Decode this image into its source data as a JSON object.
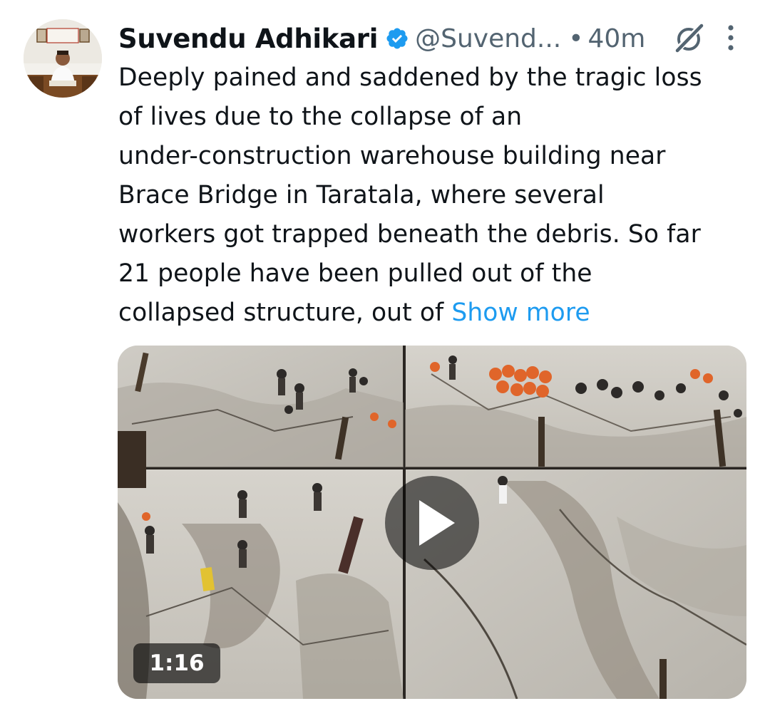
{
  "tweet": {
    "author_name": "Suvendu Adhikari",
    "handle": "@Suvend...",
    "separator": "•",
    "time": "40m",
    "verified_color": "#1d9bf0",
    "text_lines": [
      "Deeply pained and saddened by the tragic loss",
      "of lives due to the collapse of an",
      "under-construction warehouse building near",
      "Brace Bridge in Taratala, where several",
      "workers got trapped beneath the debris. So far",
      "21 people have been pulled out of the",
      "collapsed structure, out of "
    ],
    "show_more": "Show more",
    "show_more_color": "#1d9bf0"
  },
  "media": {
    "duration": "1:16",
    "kind": "video"
  },
  "icons": {
    "verified": "verified-badge-icon",
    "grok": "grok-icon",
    "more": "more-options-icon",
    "play": "play-icon"
  }
}
